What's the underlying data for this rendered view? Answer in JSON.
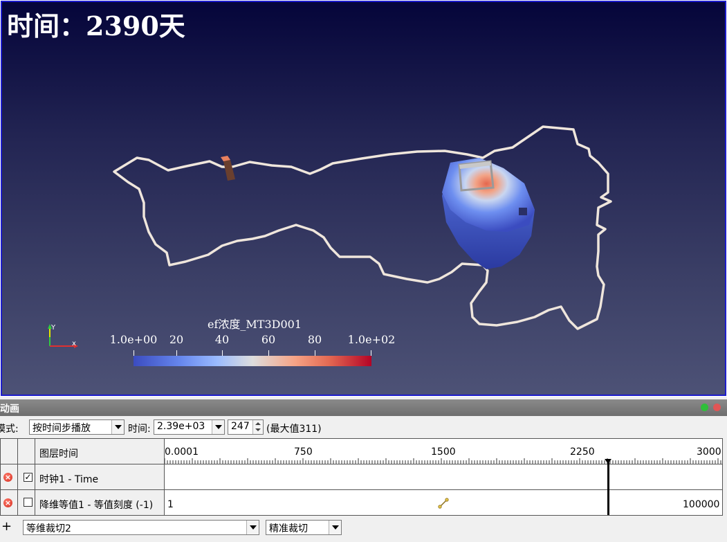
{
  "viewport": {
    "time_label": "时间：2390天",
    "legend": {
      "title": "ef浓度_MT3D001",
      "ticks": [
        {
          "label": "1.0e+00",
          "pos": 0.0
        },
        {
          "label": "20",
          "pos": 0.18
        },
        {
          "label": "40",
          "pos": 0.37
        },
        {
          "label": "60",
          "pos": 0.57
        },
        {
          "label": "80",
          "pos": 0.76
        },
        {
          "label": "1.0e+02",
          "pos": 1.0
        }
      ]
    },
    "axes": {
      "x": "x",
      "y": "Y"
    }
  },
  "animation_panel": {
    "title": "动画",
    "mode_label": "模式:",
    "mode_value": "按时间步播放",
    "time_label": "时间:",
    "time_value": "2.39e+03",
    "step_value": "247",
    "max_text": "(最大值311)",
    "header_column": "图层时间",
    "timeline": {
      "start": 0.0001,
      "end": 3000,
      "current": 2390,
      "tick_labels": [
        {
          "label": "0.0001",
          "value": 0.0001
        },
        {
          "label": "750",
          "value": 750
        },
        {
          "label": "1500",
          "value": 1500
        },
        {
          "label": "2250",
          "value": 2250
        },
        {
          "label": "3000",
          "value": 3000
        }
      ]
    },
    "tracks": [
      {
        "name": "时钟1 - Time",
        "checked": true,
        "check_mark": "✓",
        "start_value": "",
        "end_value": ""
      },
      {
        "name": "降维等值1 - 等值刻度 (-1)",
        "checked": false,
        "check_mark": "",
        "start_value": "1",
        "end_value": "100000"
      }
    ],
    "add_label": "+",
    "source_select": "等维裁切2",
    "property_select": "精准裁切"
  },
  "colors": {
    "viewport_border": "#1c1ccc",
    "path_stroke": "#efe6dc",
    "plume_low": "#3b4cc0",
    "plume_high": "#b40426"
  }
}
